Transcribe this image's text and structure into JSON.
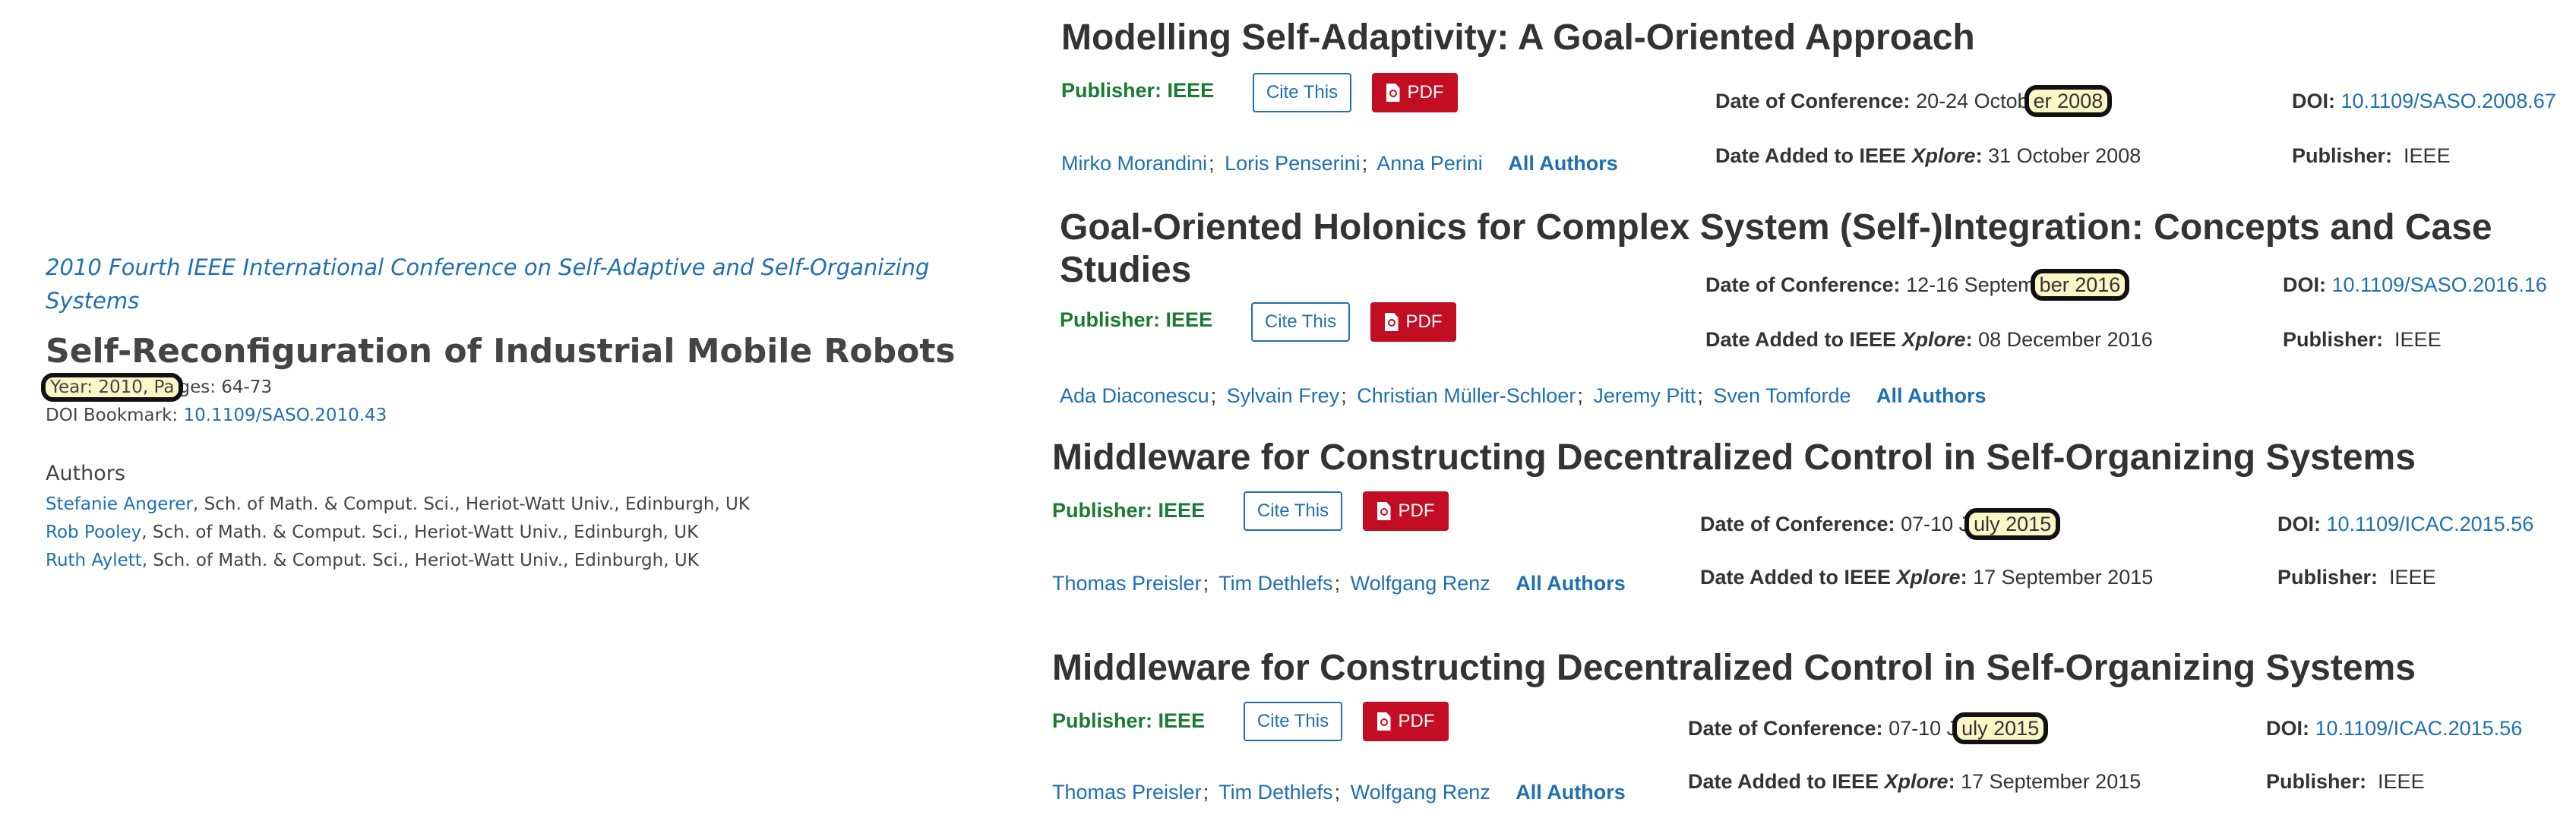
{
  "left": {
    "conference": "2010 Fourth IEEE International Conference on Self-Adaptive and Self-Organizing Systems",
    "title": "Self-Reconfiguration of Industrial Mobile Robots",
    "year_label": "Year:",
    "year": "2010,",
    "pages_label": "Pages:",
    "pages": "64-73",
    "doi_label": "DOI Bookmark:",
    "doi": "10.1109/SASO.2010.43",
    "authors_heading": "Authors",
    "authors": [
      {
        "name": "Stefanie Angerer",
        "affiliation": ", Sch. of Math. & Comput. Sci., Heriot-Watt Univ., Edinburgh, UK"
      },
      {
        "name": "Rob Pooley",
        "affiliation": ", Sch. of Math. & Comput. Sci., Heriot-Watt Univ., Edinburgh, UK"
      },
      {
        "name": "Ruth Aylett",
        "affiliation": ", Sch. of Math. & Comput. Sci., Heriot-Watt Univ., Edinburgh, UK"
      }
    ]
  },
  "labels": {
    "publisher": "Publisher:",
    "cite": "Cite This",
    "pdf": "PDF",
    "date_conf": "Date of Conference:",
    "date_added_pre": "Date Added to IEEE ",
    "xplore": "Xplore",
    "doi": "DOI:",
    "all_authors": "All Authors"
  },
  "results": [
    {
      "title": "Modelling Self-Adaptivity: A Goal-Oriented Approach",
      "publisher": "IEEE",
      "conf_date_pre": "20-24 Octob",
      "conf_date_hl": "er 2008",
      "date_added": "31 October 2008",
      "doi": "10.1109/SASO.2008.67",
      "publisher2": "IEEE",
      "authors": [
        "Mirko Morandini",
        "Loris Penserini",
        "Anna Perini"
      ]
    },
    {
      "title": "Goal-Oriented Holonics for Complex System (Self-)Integration: Concepts and Case Studies",
      "publisher": "IEEE",
      "conf_date_pre": "12-16 Septem",
      "conf_date_hl": "ber 2016",
      "date_added": "08 December 2016",
      "doi": "10.1109/SASO.2016.16",
      "publisher2": "IEEE",
      "authors": [
        "Ada Diaconescu",
        "Sylvain Frey",
        "Christian Müller-Schloer",
        "Jeremy Pitt",
        "Sven Tomforde"
      ]
    },
    {
      "title": "Middleware for Constructing Decentralized Control in Self-Organizing Systems",
      "publisher": "IEEE",
      "conf_date_pre": "07-10 J",
      "conf_date_hl": "uly 2015",
      "date_added": "17 September 2015",
      "doi": "10.1109/ICAC.2015.56",
      "publisher2": "IEEE",
      "authors": [
        "Thomas Preisler",
        "Tim Dethlefs",
        "Wolfgang Renz"
      ]
    },
    {
      "title": "Middleware for Constructing Decentralized Control in Self-Organizing Systems",
      "publisher": "IEEE",
      "conf_date_pre": "07-10 J",
      "conf_date_hl": "uly 2015",
      "date_added": "17 September 2015",
      "doi": "10.1109/ICAC.2015.56",
      "publisher2": "IEEE",
      "authors": [
        "Thomas Preisler",
        "Tim Dethlefs",
        "Wolfgang Renz"
      ]
    }
  ]
}
